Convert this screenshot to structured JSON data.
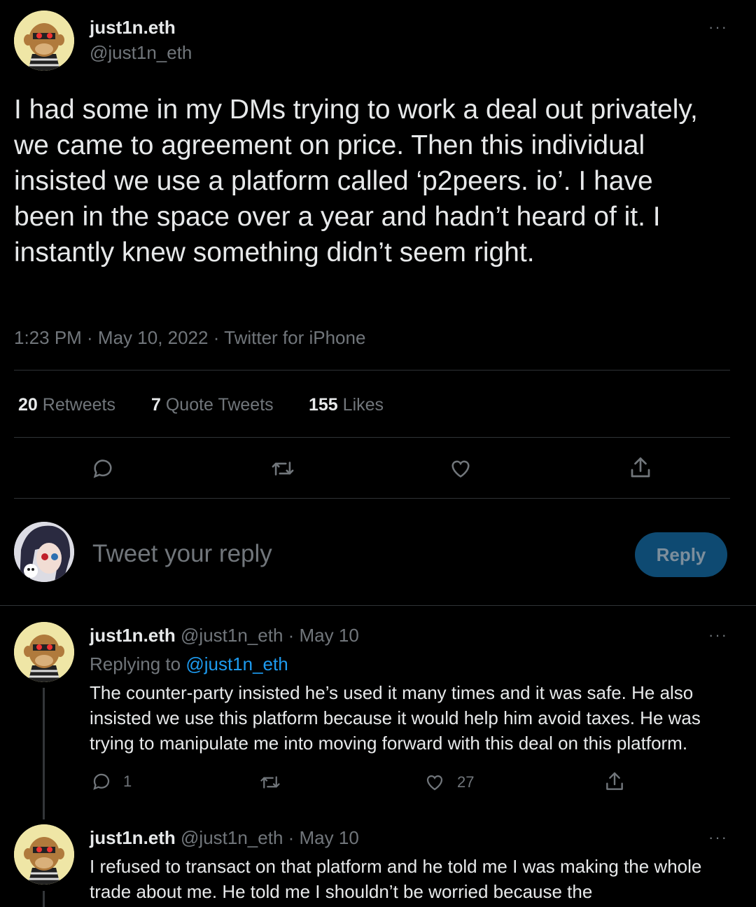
{
  "main_tweet": {
    "display_name": "just1n.eth",
    "handle": "@just1n_eth",
    "more": "···",
    "text": "I had some in my DMs trying to work a deal out privately, we came to agreement on price. Then this individual insisted we use a platform called ‘p2peers. io’. I have been in the space over a year and hadn’t heard of it. I instantly knew something didn’t seem right.",
    "meta": "1:23 PM · May 10, 2022 · Twitter for iPhone",
    "stats": {
      "retweets_count": "20",
      "retweets_label": "Retweets",
      "quotes_count": "7",
      "quotes_label": "Quote Tweets",
      "likes_count": "155",
      "likes_label": "Likes"
    }
  },
  "composer": {
    "placeholder": "Tweet your reply",
    "button": "Reply"
  },
  "replies": [
    {
      "display_name": "just1n.eth",
      "handle_date": "@just1n_eth · May 10",
      "replying_prefix": "Replying to",
      "replying_handle": "@just1n_eth",
      "text": "The counter-party insisted he’s used it many times and it was safe. He also insisted we use this platform because it would help him avoid taxes. He was trying to manipulate me into moving forward with this deal on this platform.",
      "reply_count": "1",
      "like_count": "27"
    },
    {
      "display_name": "just1n.eth",
      "handle_date": "@just1n_eth · May 10",
      "text": "I refused to transact on that platform and he told me I was making the whole trade about me. He told me I shouldn’t be worried because the"
    }
  ],
  "colors": {
    "background": "#000000",
    "accent": "#1d9bf0",
    "reply_button": "#0e4a72",
    "muted": "#71767b"
  }
}
